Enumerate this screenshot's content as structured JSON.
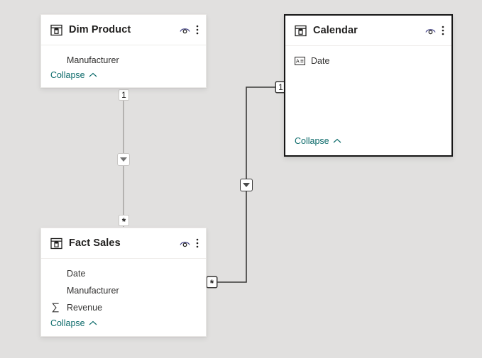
{
  "canvas": {
    "background_color": "#e1e0df",
    "name": "model-view-canvas"
  },
  "tables": [
    {
      "id": "dim-product",
      "name": "Dim Product",
      "selected": false,
      "header_icon": "table-icon",
      "actions": {
        "hide_label": "Hide in report view",
        "hide_icon": "eye-icon",
        "menu_label": "More options",
        "menu_icon": "kebab-menu-icon"
      },
      "fields": [
        {
          "name": "Manufacturer",
          "icon": "none"
        }
      ],
      "collapse_label": "Collapse",
      "collapse_icon": "chevron-up-icon"
    },
    {
      "id": "calendar",
      "name": "Calendar",
      "selected": true,
      "header_icon": "table-icon",
      "actions": {
        "hide_label": "Hide in report view",
        "hide_icon": "eye-icon",
        "menu_label": "More options",
        "menu_icon": "kebab-menu-icon"
      },
      "fields": [
        {
          "name": "Date",
          "icon": "calculated-column-icon"
        }
      ],
      "collapse_label": "Collapse",
      "collapse_icon": "chevron-up-icon"
    },
    {
      "id": "fact-sales",
      "name": "Fact Sales",
      "selected": false,
      "header_icon": "table-icon",
      "actions": {
        "hide_label": "Hide in report view",
        "hide_icon": "eye-icon",
        "menu_label": "More options",
        "menu_icon": "kebab-menu-icon"
      },
      "fields": [
        {
          "name": "Date",
          "icon": "none"
        },
        {
          "name": "Manufacturer",
          "icon": "none"
        },
        {
          "name": "Revenue",
          "icon": "sum-sigma-icon"
        }
      ],
      "collapse_label": "Collapse",
      "collapse_icon": "chevron-up-icon"
    }
  ],
  "relationships": [
    {
      "id": "rel-dimproduct-factsales",
      "from_table": "Dim Product",
      "to_table": "Fact Sales",
      "from_cardinality": "1",
      "to_cardinality": "*",
      "cross_filter_direction": "single",
      "direction_icon": "filter-arrow-down-icon",
      "highlighted": false
    },
    {
      "id": "rel-calendar-factsales",
      "from_table": "Calendar",
      "to_table": "Fact Sales",
      "from_cardinality": "1",
      "to_cardinality": "*",
      "cross_filter_direction": "single",
      "direction_icon": "filter-arrow-down-icon",
      "highlighted": true
    }
  ]
}
